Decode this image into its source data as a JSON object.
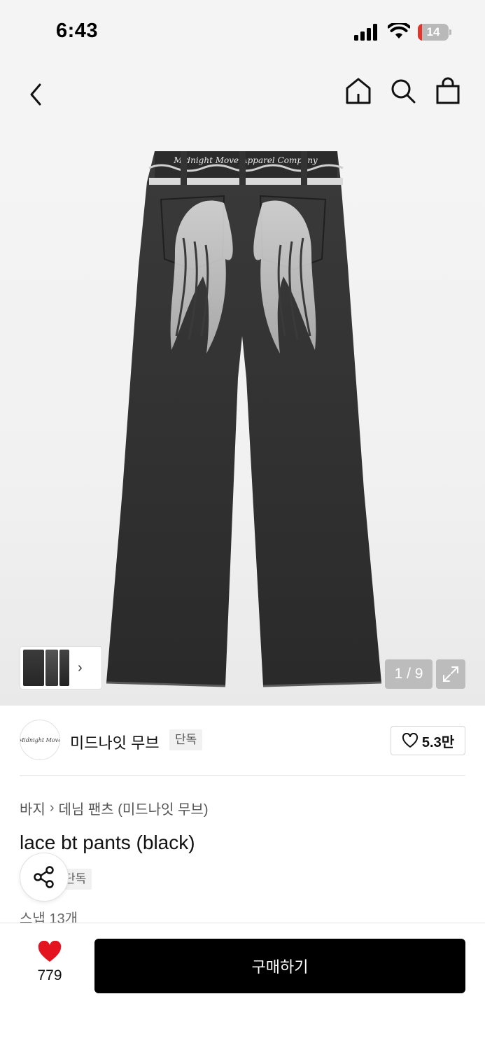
{
  "status_bar": {
    "time": "6:43",
    "battery_level": "14",
    "icons": [
      "cellular-signal-icon",
      "wifi-icon",
      "battery-icon"
    ]
  },
  "nav": {
    "icons": [
      "back-chevron-icon",
      "home-icon",
      "search-icon",
      "shopping-bag-icon"
    ]
  },
  "gallery": {
    "counter": "1 / 9",
    "current_image": 1,
    "total_images": 9,
    "brand_waistband_text": "Midnight Move Apparel Company"
  },
  "brand": {
    "logo_text": "Midnight Move",
    "name": "미드나잇 무브",
    "badge": "단독",
    "likes": "5.3만"
  },
  "product": {
    "breadcrumb": [
      "바지",
      "데님 팬츠 (미드나잇 무브)"
    ],
    "title": "lace bt pants (black)",
    "badge": "단독",
    "snap_count": "스냅 13개"
  },
  "bottom_bar": {
    "wish_count": "779",
    "buy_label": "구매하기"
  },
  "colors": {
    "heart_red": "#e3141f",
    "buy_button": "#000000",
    "battery_red": "#e5352b"
  }
}
